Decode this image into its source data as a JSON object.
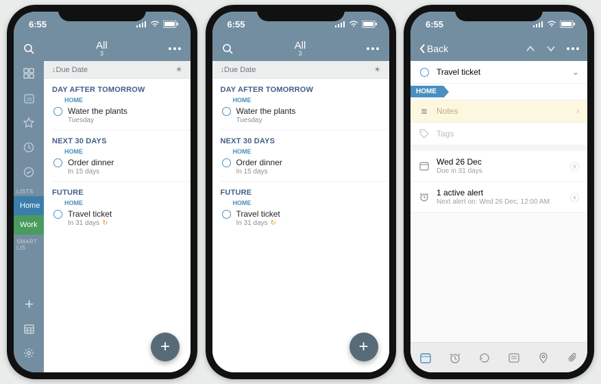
{
  "status": {
    "time": "6:55"
  },
  "listview": {
    "title": "All",
    "count": "3",
    "sort_label": "Due Date",
    "sections": [
      {
        "header": "DAY AFTER TOMORROW",
        "tag": "HOME",
        "task": {
          "title": "Water the plants",
          "sub": "Tuesday",
          "recurring": false
        }
      },
      {
        "header": "NEXT 30 DAYS",
        "tag": "HOME",
        "task": {
          "title": "Order dinner",
          "sub": "In 15 days",
          "recurring": false
        }
      },
      {
        "header": "FUTURE",
        "tag": "HOME",
        "task": {
          "title": "Travel ticket",
          "sub": "In 31 days",
          "recurring": true
        }
      }
    ]
  },
  "sidebar": {
    "section_lists": "LISTS",
    "section_smart": "SMART LIS",
    "list_home": "Home",
    "list_work": "Work"
  },
  "detail": {
    "back": "Back",
    "title": "Travel ticket",
    "tag": "HOME",
    "notes_placeholder": "Notes",
    "tags_placeholder": "Tags",
    "date": {
      "title": "Wed 26 Dec",
      "sub": "Due in 31 days"
    },
    "alert": {
      "title": "1 active alert",
      "sub": "Next alert on: Wed 26 Dec, 12:00 AM"
    }
  }
}
